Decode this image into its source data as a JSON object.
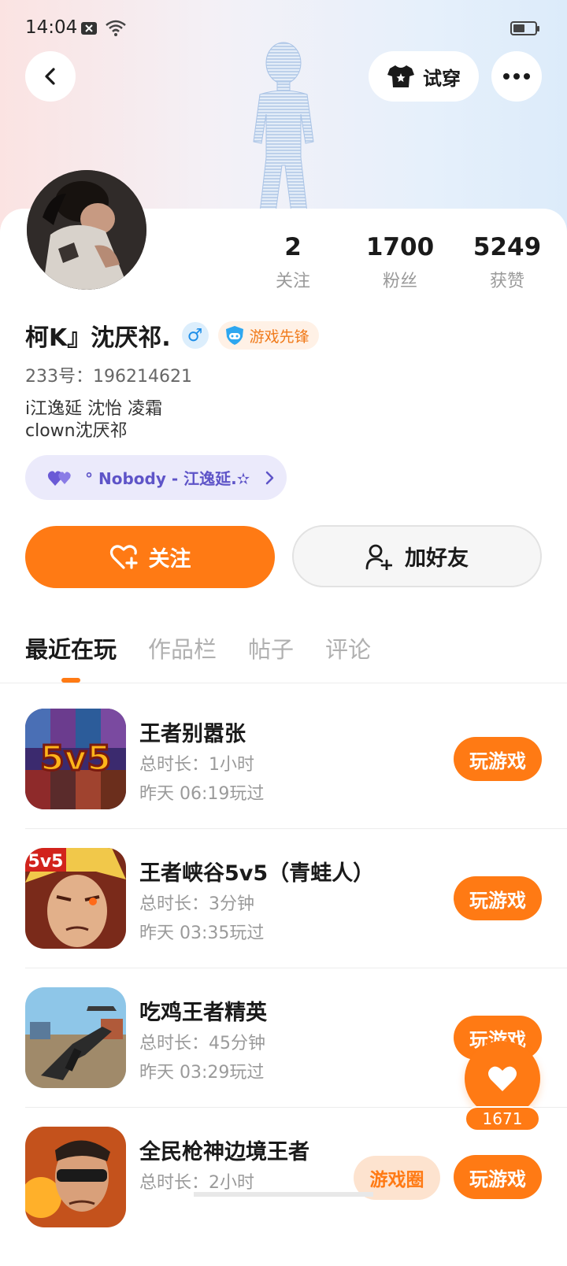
{
  "status_bar": {
    "time": "14:04",
    "battery_level": 0.55
  },
  "header": {
    "tryon_label": "试穿"
  },
  "profile": {
    "stats": [
      {
        "value": "2",
        "label": "关注"
      },
      {
        "value": "1700",
        "label": "粉丝"
      },
      {
        "value": "5249",
        "label": "获赞"
      }
    ],
    "name": "柯K』沈厌祁.",
    "gender_symbol": "♂",
    "badge_label": "游戏先锋",
    "uid": "233号：196214621",
    "bio_line1": "i江逸延 沈怡 凌霜",
    "bio_line2": "clown沈厌祁",
    "music_label": "° Nobody - 江逸延.✫"
  },
  "actions": {
    "follow_label": "关注",
    "add_friend_label": "加好友"
  },
  "tabs": [
    "最近在玩",
    "作品栏",
    "帖子",
    "评论"
  ],
  "games": [
    {
      "title": "王者别嚣张",
      "duration": "总时长：1小时",
      "last_played": "昨天 06:19玩过",
      "button": "玩游戏",
      "icon": "game-icon-5v5-heroes",
      "icon_text": "5v5"
    },
    {
      "title": "王者峡谷5v5（青蛙人）",
      "duration": "总时长：3分钟",
      "last_played": "昨天 03:35玩过",
      "button": "玩游戏",
      "icon": "game-icon-5v5-hero-face",
      "icon_text": "5v5"
    },
    {
      "title": "吃鸡王者精英",
      "duration": "总时长：45分钟",
      "last_played": "昨天 03:29玩过",
      "button": "玩游戏",
      "icon": "game-icon-gun"
    },
    {
      "title": "全民枪神边境王者",
      "duration": "总时长：2小时",
      "last_played": "",
      "button": "玩游戏",
      "icon": "game-icon-soldier"
    }
  ],
  "floating": {
    "like_count": "1671",
    "circle_label": "游戏圈"
  },
  "colors": {
    "accent": "#ff7a14",
    "music": "#5e54c8",
    "gender": "#1e8ee8"
  }
}
